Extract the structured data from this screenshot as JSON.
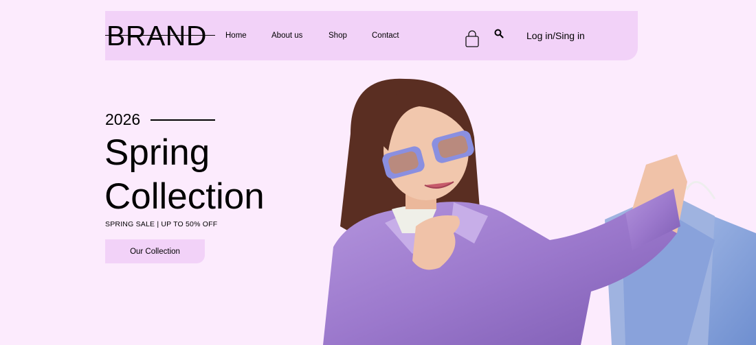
{
  "brand": {
    "logo": "BRAND"
  },
  "nav": {
    "links": [
      {
        "label": "Home"
      },
      {
        "label": "About us"
      },
      {
        "label": "Shop"
      },
      {
        "label": "Contact"
      }
    ],
    "bag_icon": "shopping-bag-icon",
    "search_icon": "search-icon",
    "login_label": "Log in/Sing in"
  },
  "hero": {
    "year": "2026",
    "title_line1": "Spring",
    "title_line2": "Collection",
    "subtitle": "SPRING SALE | UP TO 50% OFF",
    "cta_label": "Our Collection",
    "image_subject": "woman in purple leather jacket and sunglasses holding shopping bags"
  },
  "colors": {
    "background": "#fcebfd",
    "nav_background": "#f2d2f8",
    "button_background": "#f2d2f8",
    "text": "#000000"
  }
}
